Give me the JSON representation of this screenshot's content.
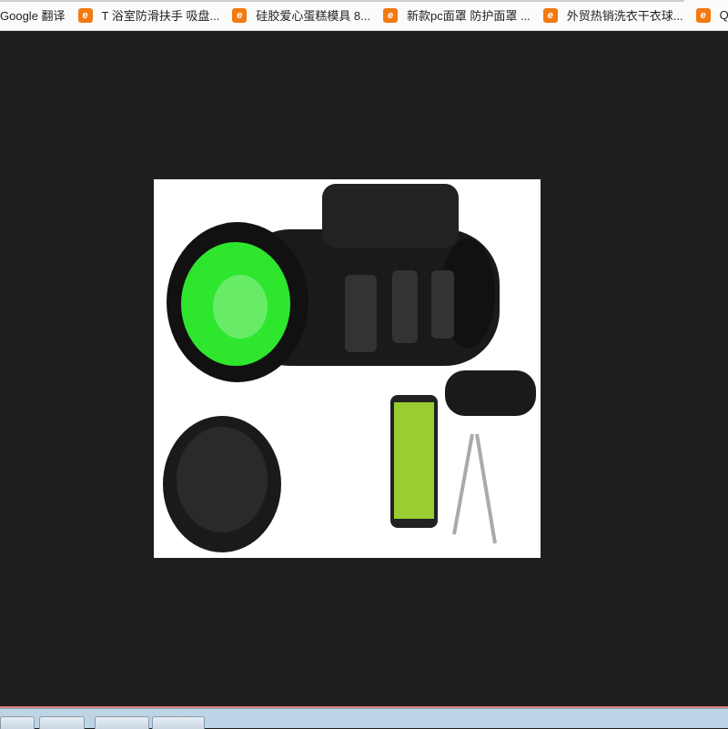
{
  "bookmarks": [
    {
      "label": "Google 翻译",
      "icon": "none"
    },
    {
      "label": "T 浴室防滑扶手 吸盘...",
      "icon": "alibaba-icon"
    },
    {
      "label": "硅胶爱心蛋糕模具 8...",
      "icon": "alibaba-icon"
    },
    {
      "label": "新款pc面罩 防护面罩 ...",
      "icon": "alibaba-icon"
    },
    {
      "label": "外贸热销洗衣干衣球...",
      "icon": "alibaba-icon"
    },
    {
      "label": "Quick Pivot",
      "icon": "alibaba-icon"
    }
  ],
  "alibaba_glyph": "e",
  "colors": {
    "accent": "#f27a12",
    "lens": "#2ee62e"
  }
}
